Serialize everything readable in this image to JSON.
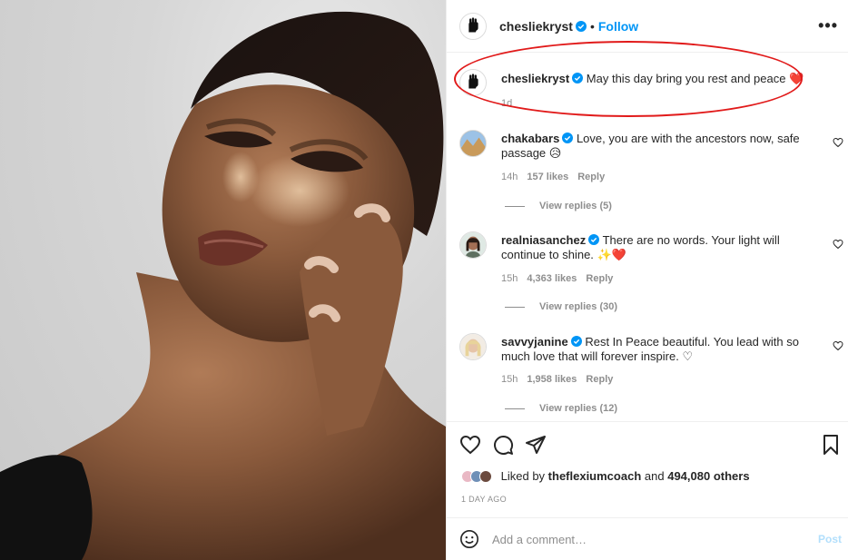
{
  "post": {
    "owner": "chesliekryst",
    "follow_label": "Follow",
    "more_label": "•••",
    "caption": {
      "username": "chesliekryst",
      "text": "May this day bring you rest and peace",
      "emoji": "❤️",
      "time": "1d"
    }
  },
  "comments": [
    {
      "username": "chakabars",
      "text": "Love, you are with the ancestors now, safe passage",
      "emoji": "😥",
      "time": "14h",
      "likes": "157 likes",
      "reply_label": "Reply",
      "view_replies": "View replies (5)"
    },
    {
      "username": "realniasanchez",
      "text": "There are no words. Your light will continue to shine.",
      "emoji": "✨❤️",
      "time": "15h",
      "likes": "4,363 likes",
      "reply_label": "Reply",
      "view_replies": "View replies (30)"
    },
    {
      "username": "savvyjanine",
      "text": "Rest In Peace beautiful. You lead with so much love that will forever inspire.",
      "emoji": "♡",
      "time": "15h",
      "likes": "1,958 likes",
      "reply_label": "Reply",
      "view_replies": "View replies (12)"
    }
  ],
  "likes": {
    "prefix": "Liked by",
    "user": "theflexiumcoach",
    "middle": "and",
    "count": "494,080 others"
  },
  "time_ago": "1 DAY AGO",
  "comment_box": {
    "placeholder": "Add a comment…",
    "post_label": "Post"
  },
  "icons": {
    "like": "heart-icon",
    "comment": "comment-icon",
    "share": "share-icon",
    "save": "bookmark-icon",
    "emoji": "smiley-icon",
    "verified": "verified-badge-icon"
  },
  "colors": {
    "accent": "#0095f6",
    "annotation": "#e11a1a",
    "muted": "#8e8e8e"
  }
}
